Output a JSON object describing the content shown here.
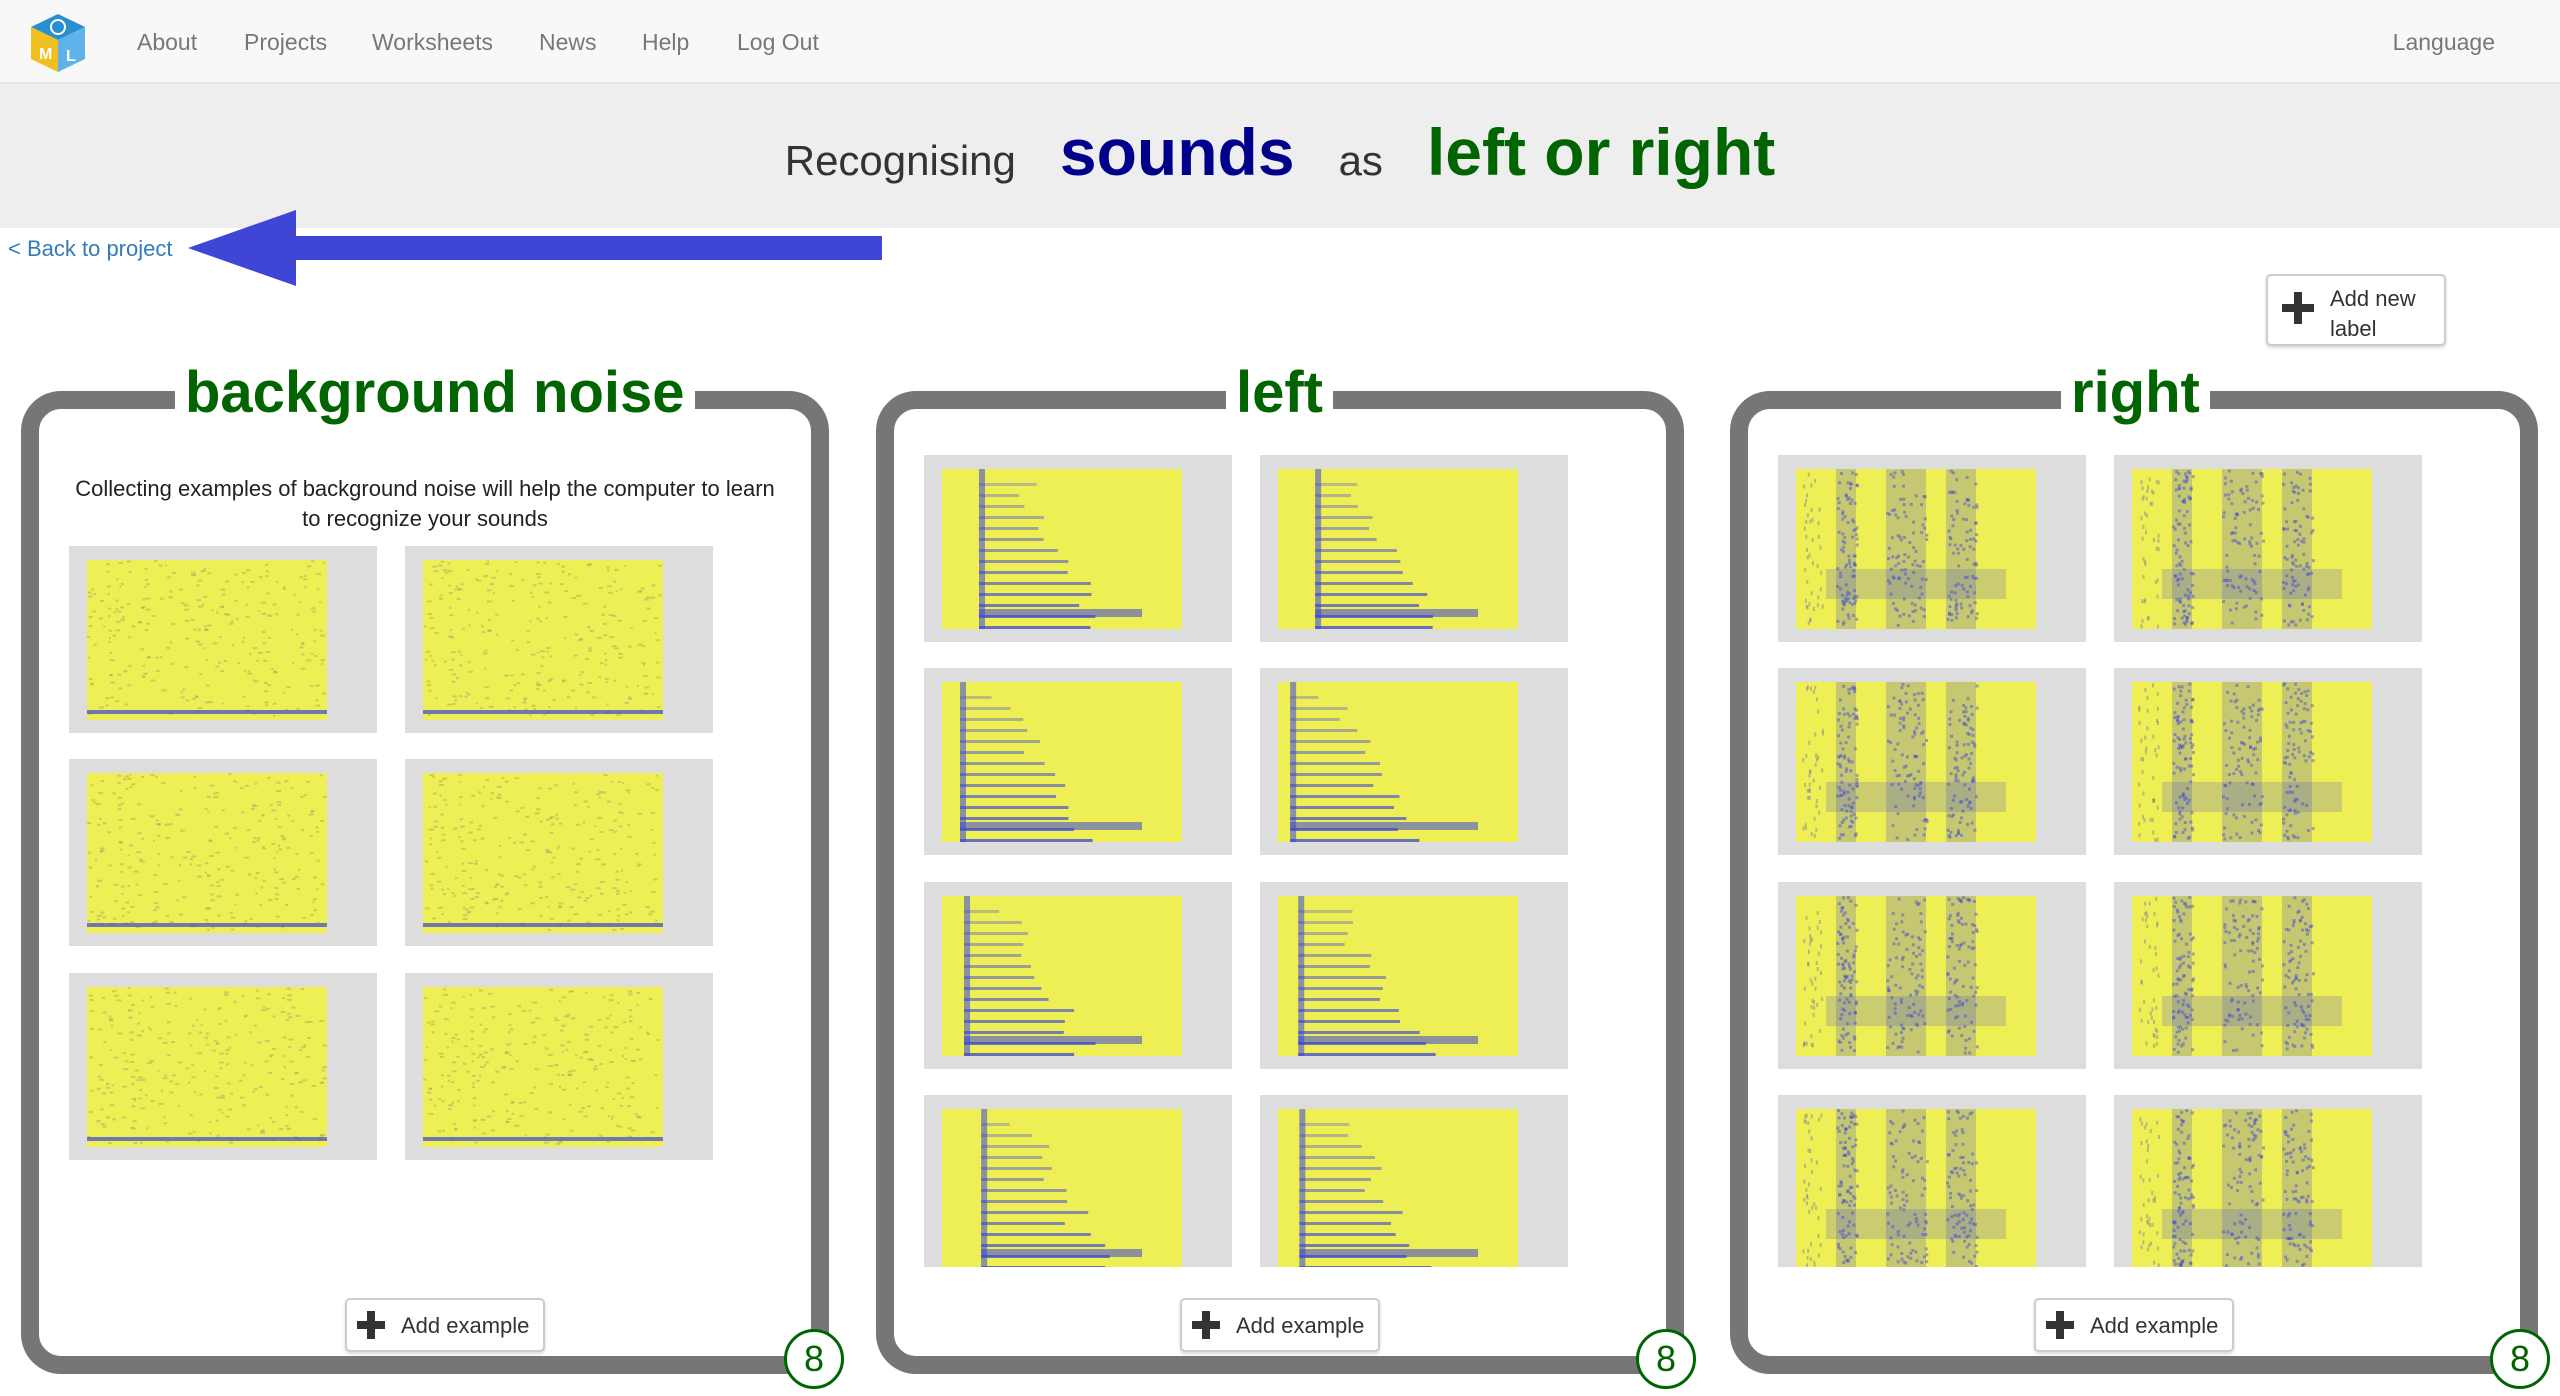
{
  "nav": {
    "logo_letters": [
      "M",
      "L"
    ],
    "links": [
      "About",
      "Projects",
      "Worksheets",
      "News",
      "Help",
      "Log Out"
    ],
    "language": "Language"
  },
  "header": {
    "prefix": "Recognising",
    "subject": "sounds",
    "connector": "as",
    "labels": "left or right"
  },
  "back_link": "< Back to project",
  "add_label": "Add new label",
  "colors": {
    "accent_green": "#006400",
    "accent_navy": "#00008b",
    "link_blue": "#337ab7",
    "arrow_blue": "#3f45d4",
    "spectrogram_bg": "#eeee55",
    "spectrogram_ink": "#3a45d8"
  },
  "buckets": [
    {
      "title": "background noise",
      "description": "Collecting examples of background noise will help the computer to learn to recognize your sounds",
      "add_example": "Add example",
      "count": "8",
      "pattern": "noise"
    },
    {
      "title": "left",
      "description": "",
      "add_example": "Add example",
      "count": "8",
      "pattern": "left"
    },
    {
      "title": "right",
      "description": "",
      "add_example": "Add example",
      "count": "8",
      "pattern": "right"
    }
  ]
}
